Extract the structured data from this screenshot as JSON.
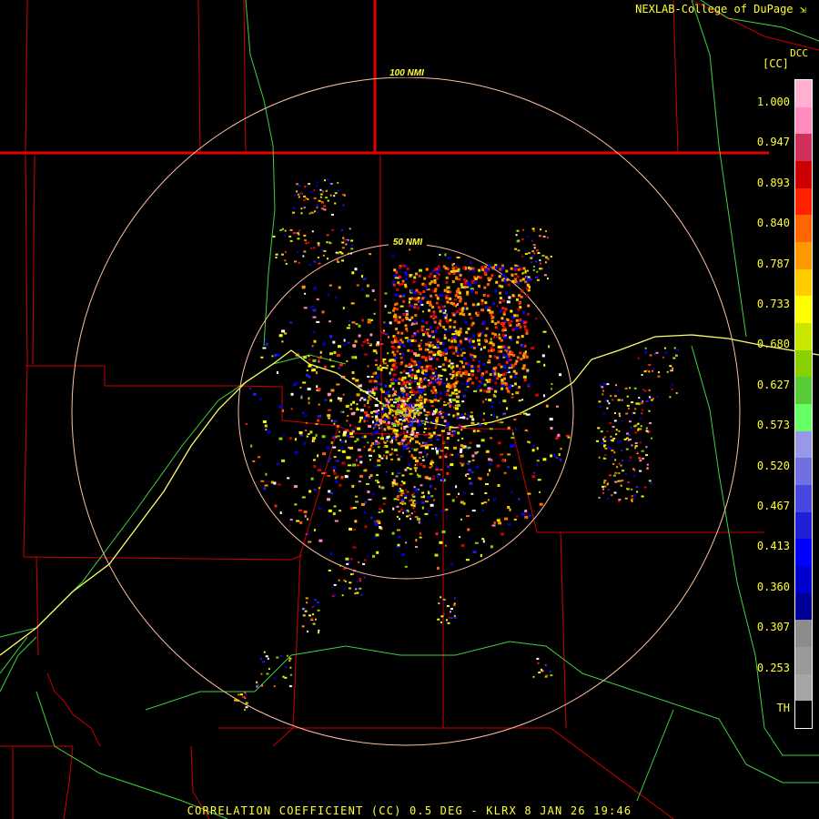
{
  "header": {
    "credit": "NEXLAB-College of DuPage",
    "credit_icon": "corner-arrow-icon",
    "radar_id": "DCC",
    "unit": "[CC]"
  },
  "rings": [
    {
      "label": "100 NMI"
    },
    {
      "label": "50 NMI"
    }
  ],
  "legend": {
    "labels": [
      "1.000",
      "0.947",
      "0.893",
      "0.840",
      "0.787",
      "0.733",
      "0.680",
      "0.627",
      "0.573",
      "0.520",
      "0.467",
      "0.413",
      "0.360",
      "0.307",
      "0.253",
      "TH"
    ],
    "colors": [
      "#ffb0d0",
      "#ff8cbf",
      "#d0305a",
      "#cc0000",
      "#ff2200",
      "#ff6600",
      "#ff9900",
      "#ffcc00",
      "#ffff00",
      "#c8e600",
      "#88d000",
      "#58cc38",
      "#66ff66",
      "#9898e8",
      "#7070e0",
      "#4848e0",
      "#2020d8",
      "#0000ff",
      "#0000cc",
      "#000099",
      "#8c8c8c",
      "#9a9a9a",
      "#a6a6a6",
      "#000000"
    ]
  },
  "colors": {
    "boundary": "#cc0000",
    "boundary_thick": "#e00000",
    "road": "#40d040",
    "river": "#ffff66",
    "ring": "#ffbfa0",
    "text": "#ffff33"
  },
  "footer": {
    "title": "CORRELATION COEFFICIENT (CC) 0.5 DEG - KLRX 8 JAN 26 19:46"
  }
}
